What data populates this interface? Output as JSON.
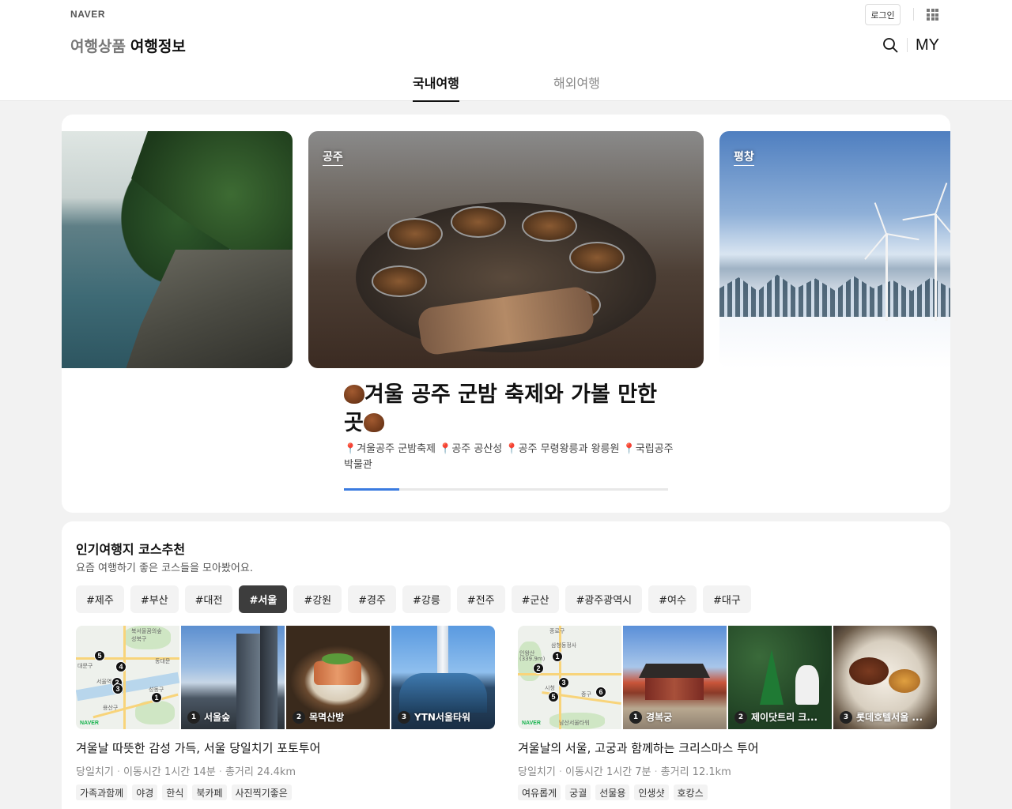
{
  "header": {
    "logo": "NAVER",
    "login_label": "로그인",
    "brand_sub": "여행상품",
    "brand_main": "여행정보",
    "my_label": "MY",
    "tabs": [
      {
        "label": "국내여행",
        "active": true
      },
      {
        "label": "해외여행",
        "active": false
      }
    ]
  },
  "carousel": {
    "slides": [
      {
        "tag": ""
      },
      {
        "tag": "공주"
      },
      {
        "tag": "평창"
      }
    ],
    "title": "겨울 공주 군밤 축제와 가볼 만한 곳",
    "desc_items": [
      "겨울공주 군밤축제",
      "공주 공산성",
      "공주 무령왕릉과 왕릉원",
      "국립공주박물관"
    ],
    "progress": 0.17
  },
  "courses": {
    "title": "인기여행지 코스추천",
    "subtitle": "요즘 여행하기 좋은 코스들을 모아봤어요.",
    "chips": [
      {
        "label": "#제주"
      },
      {
        "label": "#부산"
      },
      {
        "label": "#대전"
      },
      {
        "label": "#서울",
        "active": true
      },
      {
        "label": "#강원"
      },
      {
        "label": "#경주"
      },
      {
        "label": "#강릉"
      },
      {
        "label": "#전주"
      },
      {
        "label": "#군산"
      },
      {
        "label": "#광주광역시"
      },
      {
        "label": "#여수"
      },
      {
        "label": "#대구"
      }
    ],
    "items": [
      {
        "map_labels": [
          "북서울꿈의숲",
          "성북구",
          "동대문",
          "대문구",
          "서울역",
          "성동구",
          "용산구",
          "NAVER"
        ],
        "places": [
          {
            "num": "1",
            "name": "서울숲"
          },
          {
            "num": "2",
            "name": "목멱산방"
          },
          {
            "num": "3",
            "name": "YTN서울타워"
          }
        ],
        "title": "겨울날 따뜻한 감성 가득, 서울 당일치기 포토투어",
        "meta": [
          "당일치기",
          "이동시간 1시간 14분",
          "총거리 24.4km"
        ],
        "tags": [
          "가족과함께",
          "야경",
          "한식",
          "북카페",
          "사진찍기좋은"
        ]
      },
      {
        "map_labels": [
          "종로구",
          "삼청동정사",
          "인왕산",
          "(339.9m)",
          "시청",
          "중구",
          "남산서울타워",
          "NAVER"
        ],
        "places": [
          {
            "num": "1",
            "name": "경복궁"
          },
          {
            "num": "2",
            "name": "제이닷트리 크..."
          },
          {
            "num": "3",
            "name": "롯데호텔서울 ..."
          }
        ],
        "title": "겨울날의 서울, 고궁과 함께하는 크리스마스 투어",
        "meta": [
          "당일치기",
          "이동시간 1시간 7분",
          "총거리 12.1km"
        ],
        "tags": [
          "여유롭게",
          "궁궐",
          "선물용",
          "인생샷",
          "호캉스"
        ]
      }
    ]
  }
}
